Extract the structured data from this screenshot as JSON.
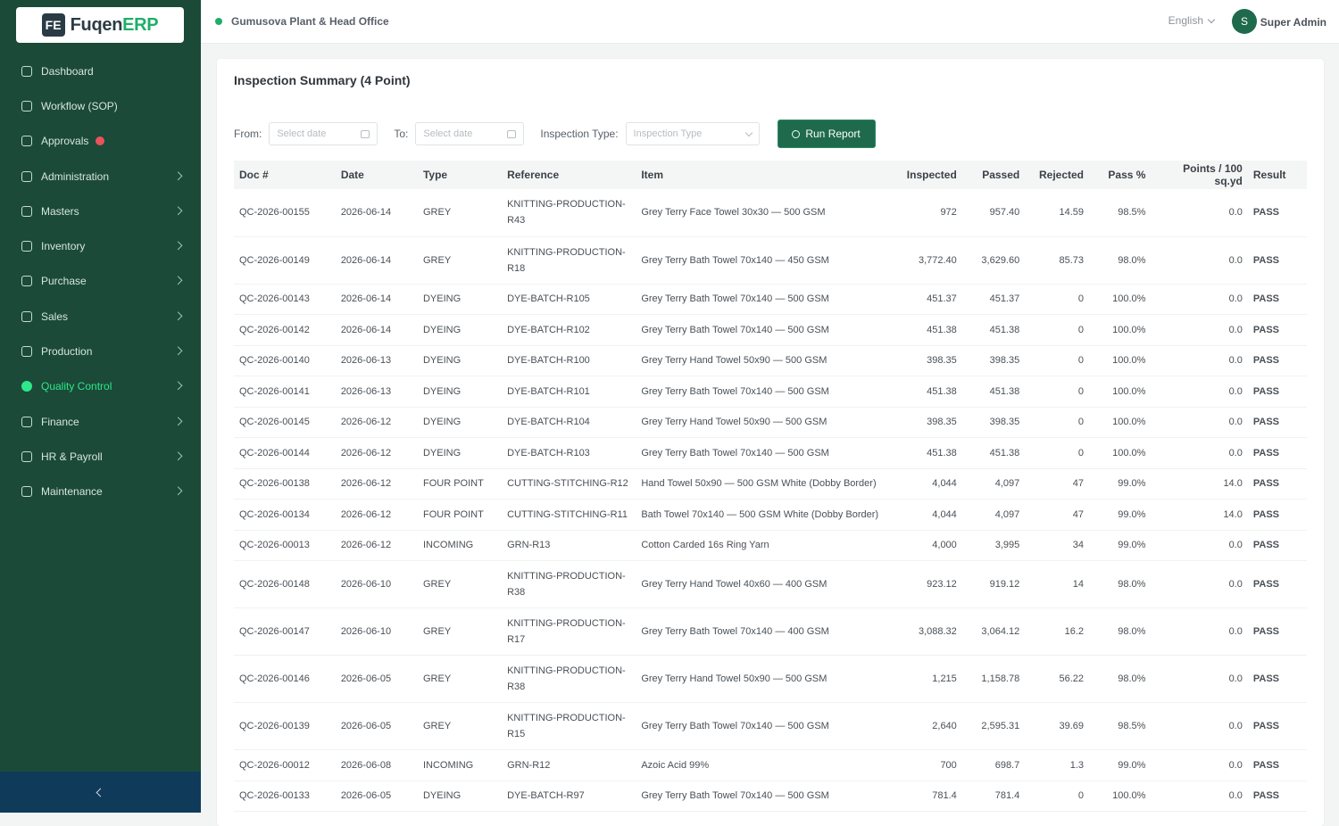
{
  "brand": {
    "name": "Fuqen",
    "suffix": "ERP",
    "mark": "FE"
  },
  "sidebar": {
    "items": [
      {
        "label": "Dashboard",
        "icon": "dashboard-icon",
        "chevron": false
      },
      {
        "label": "Workflow (SOP)",
        "icon": "workflow-icon",
        "chevron": false
      },
      {
        "label": "Approvals",
        "icon": "approvals-icon",
        "chevron": false,
        "badge": true
      },
      {
        "label": "Administration",
        "icon": "admin-icon",
        "chevron": true
      },
      {
        "label": "Masters",
        "icon": "masters-icon",
        "chevron": true
      },
      {
        "label": "Inventory",
        "icon": "inventory-icon",
        "chevron": true
      },
      {
        "label": "Purchase",
        "icon": "purchase-icon",
        "chevron": true
      },
      {
        "label": "Sales",
        "icon": "sales-icon",
        "chevron": true
      },
      {
        "label": "Production",
        "icon": "production-icon",
        "chevron": true
      },
      {
        "label": "Quality Control",
        "icon": "quality-icon",
        "chevron": true,
        "active": true
      },
      {
        "label": "Finance",
        "icon": "finance-icon",
        "chevron": true
      },
      {
        "label": "HR & Payroll",
        "icon": "hr-icon",
        "chevron": true
      },
      {
        "label": "Maintenance",
        "icon": "maintenance-icon",
        "chevron": true
      }
    ]
  },
  "topbar": {
    "location": "Gumusova Plant & Head Office",
    "language": "English",
    "user_initial": "S",
    "user_name": "Super Admin"
  },
  "card": {
    "title": "Inspection Summary (4 Point)",
    "filters": {
      "from_label": "From:",
      "from_placeholder": "Select date",
      "to_label": "To:",
      "to_placeholder": "Select date",
      "type_label": "Inspection Type:",
      "type_placeholder": "Inspection Type",
      "run_label": "Run Report"
    }
  },
  "table": {
    "headers": [
      "Doc #",
      "Date",
      "Type",
      "Reference",
      "Item",
      "Inspected",
      "Passed",
      "Rejected",
      "Pass %",
      "Points / 100 sq.yd",
      "Result"
    ],
    "rows": [
      [
        "QC-2026-00155",
        "2026-06-14",
        "GREY",
        "KNITTING-PRODUCTION-R43",
        "Grey Terry Face Towel 30x30 — 500 GSM",
        "972",
        "957.40",
        "14.59",
        "98.5%",
        "0.0",
        "PASS"
      ],
      [
        "QC-2026-00149",
        "2026-06-14",
        "GREY",
        "KNITTING-PRODUCTION-R18",
        "Grey Terry Bath Towel 70x140 — 450 GSM",
        "3,772.40",
        "3,629.60",
        "85.73",
        "98.0%",
        "0.0",
        "PASS"
      ],
      [
        "QC-2026-00143",
        "2026-06-14",
        "DYEING",
        "DYE-BATCH-R105",
        "Grey Terry Bath Towel 70x140 — 500 GSM",
        "451.37",
        "451.37",
        "0",
        "100.0%",
        "0.0",
        "PASS"
      ],
      [
        "QC-2026-00142",
        "2026-06-14",
        "DYEING",
        "DYE-BATCH-R102",
        "Grey Terry Bath Towel 70x140 — 500 GSM",
        "451.38",
        "451.38",
        "0",
        "100.0%",
        "0.0",
        "PASS"
      ],
      [
        "QC-2026-00140",
        "2026-06-13",
        "DYEING",
        "DYE-BATCH-R100",
        "Grey Terry Hand Towel 50x90 — 500 GSM",
        "398.35",
        "398.35",
        "0",
        "100.0%",
        "0.0",
        "PASS"
      ],
      [
        "QC-2026-00141",
        "2026-06-13",
        "DYEING",
        "DYE-BATCH-R101",
        "Grey Terry Bath Towel 70x140 — 500 GSM",
        "451.38",
        "451.38",
        "0",
        "100.0%",
        "0.0",
        "PASS"
      ],
      [
        "QC-2026-00145",
        "2026-06-12",
        "DYEING",
        "DYE-BATCH-R104",
        "Grey Terry Hand Towel 50x90 — 500 GSM",
        "398.35",
        "398.35",
        "0",
        "100.0%",
        "0.0",
        "PASS"
      ],
      [
        "QC-2026-00144",
        "2026-06-12",
        "DYEING",
        "DYE-BATCH-R103",
        "Grey Terry Bath Towel 70x140 — 500 GSM",
        "451.38",
        "451.38",
        "0",
        "100.0%",
        "0.0",
        "PASS"
      ],
      [
        "QC-2026-00138",
        "2026-06-12",
        "FOUR POINT",
        "CUTTING-STITCHING-R12",
        "Hand Towel 50x90 — 500 GSM White (Dobby Border)",
        "4,044",
        "4,097",
        "47",
        "99.0%",
        "14.0",
        "PASS"
      ],
      [
        "QC-2026-00134",
        "2026-06-12",
        "FOUR POINT",
        "CUTTING-STITCHING-R11",
        "Bath Towel 70x140 — 500 GSM White (Dobby Border)",
        "4,044",
        "4,097",
        "47",
        "99.0%",
        "14.0",
        "PASS"
      ],
      [
        "QC-2026-00013",
        "2026-06-12",
        "INCOMING",
        "GRN-R13",
        "Cotton Carded 16s Ring Yarn",
        "4,000",
        "3,995",
        "34",
        "99.0%",
        "0.0",
        "PASS"
      ],
      [
        "QC-2026-00148",
        "2026-06-10",
        "GREY",
        "KNITTING-PRODUCTION-R38",
        "Grey Terry Hand Towel 40x60 — 400 GSM",
        "923.12",
        "919.12",
        "14",
        "98.0%",
        "0.0",
        "PASS"
      ],
      [
        "QC-2026-00147",
        "2026-06-10",
        "GREY",
        "KNITTING-PRODUCTION-R17",
        "Grey Terry Bath Towel 70x140 — 400 GSM",
        "3,088.32",
        "3,064.12",
        "16.2",
        "98.0%",
        "0.0",
        "PASS"
      ],
      [
        "QC-2026-00146",
        "2026-06-05",
        "GREY",
        "KNITTING-PRODUCTION-R38",
        "Grey Terry Hand Towel 50x90 — 500 GSM",
        "1,215",
        "1,158.78",
        "56.22",
        "98.0%",
        "0.0",
        "PASS"
      ],
      [
        "QC-2026-00139",
        "2026-06-05",
        "GREY",
        "KNITTING-PRODUCTION-R15",
        "Grey Terry Bath Towel 70x140 — 500 GSM",
        "2,640",
        "2,595.31",
        "39.69",
        "98.5%",
        "0.0",
        "PASS"
      ],
      [
        "QC-2026-00012",
        "2026-06-08",
        "INCOMING",
        "GRN-R12",
        "Azoic Acid 99%",
        "700",
        "698.7",
        "1.3",
        "99.0%",
        "0.0",
        "PASS"
      ],
      [
        "QC-2026-00133",
        "2026-06-05",
        "DYEING",
        "DYE-BATCH-R97",
        "Grey Terry Bath Towel 70x140 — 500 GSM",
        "781.4",
        "781.4",
        "0",
        "100.0%",
        "0.0",
        "PASS"
      ]
    ]
  }
}
